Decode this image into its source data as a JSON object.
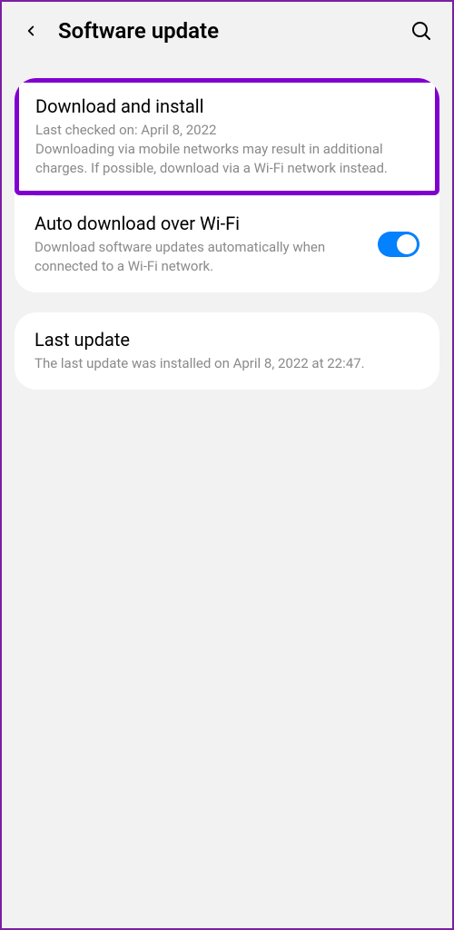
{
  "header": {
    "title": "Software update"
  },
  "download": {
    "title": "Download and install",
    "lastChecked": "Last checked on: April 8, 2022",
    "description": "Downloading via mobile networks may result in additional charges. If possible, download via a Wi-Fi network instead."
  },
  "autoDownload": {
    "title": "Auto download over Wi-Fi",
    "description": "Download software updates automatically when connected to a Wi-Fi network.",
    "enabled": true
  },
  "lastUpdate": {
    "title": "Last update",
    "description": "The last update was installed on April 8, 2022 at 22:47."
  }
}
